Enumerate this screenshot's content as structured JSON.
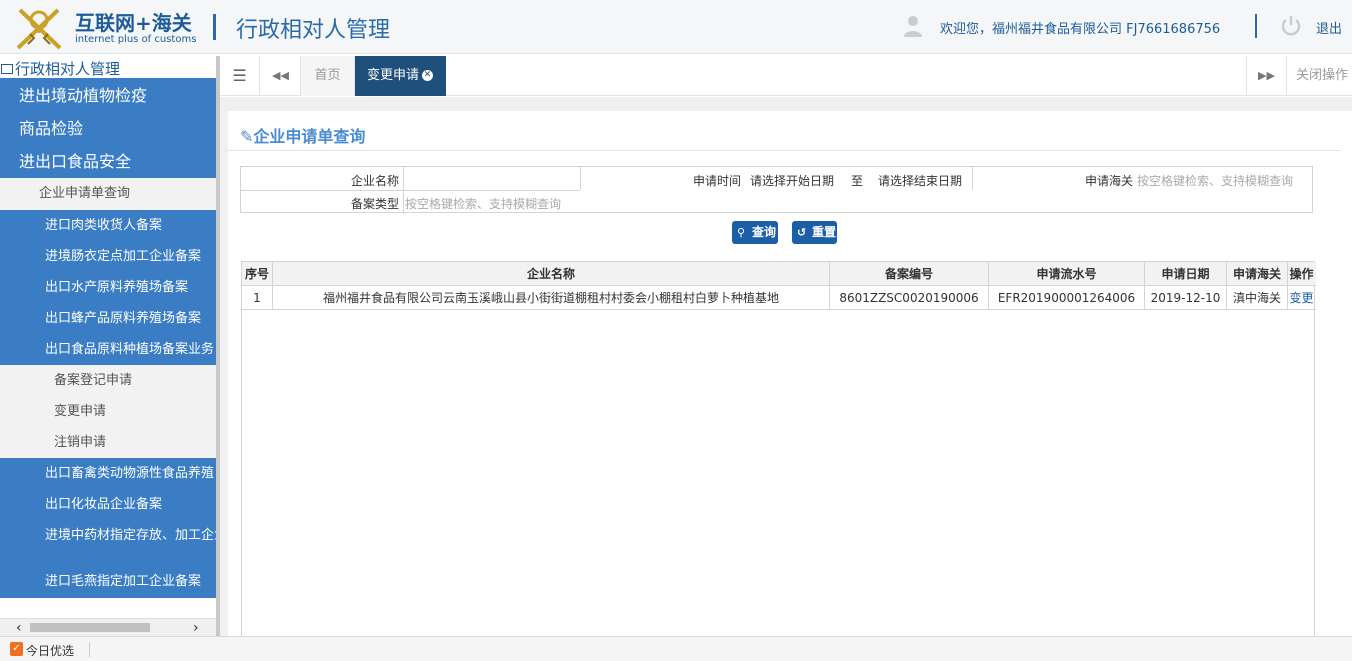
{
  "header": {
    "logo_cn": "互联网+海关",
    "logo_en": "internet plus of customs",
    "app_title": "行政相对人管理",
    "welcome": "欢迎您，福州福井食品有限公司 FJ7661686756",
    "logout": "退出"
  },
  "sidebar": {
    "root": "行政相对人管理",
    "main_items": [
      "进出境动植物检疫",
      "商品检验",
      "进出口食品安全"
    ],
    "active_item": "企业申请单查询",
    "sub_items_a": [
      "进口肉类收货人备案",
      "进境肠衣定点加工企业备案",
      "出口水产原料养殖场备案",
      "出口蜂产品原料养殖场备案",
      "出口食品原料种植场备案业务"
    ],
    "leaf_items": [
      "备案登记申请",
      "变更申请",
      "注销申请"
    ],
    "sub_items_b": [
      "出口畜禽类动物源性食品养殖",
      "出口化妆品企业备案",
      "进境中药材指定存放、加工企业"
    ],
    "sub_item_last": "进口毛燕指定加工企业备案"
  },
  "tabs": {
    "home": "首页",
    "active": "变更申请",
    "close_ops": "关闭操作"
  },
  "panel": {
    "title": "企业申请单查询"
  },
  "form": {
    "company_name_label": "企业名称",
    "apply_time_label": "申请时间",
    "start_date_placeholder": "请选择开始日期",
    "to": "至",
    "end_date_placeholder": "请选择结束日期",
    "customs_label": "申请海关",
    "customs_placeholder": "按空格键检索、支持模糊查询",
    "record_type_label": "备案类型",
    "record_type_placeholder": "按空格键检索、支持模糊查询"
  },
  "buttons": {
    "query": "查询",
    "reset": "重置"
  },
  "table": {
    "columns": [
      "序号",
      "企业名称",
      "备案编号",
      "申请流水号",
      "申请日期",
      "申请海关",
      "操作"
    ],
    "rows": [
      {
        "no": "1",
        "company": "福州福井食品有限公司云南玉溪峨山县小街街道棚租村村委会小棚租村白萝卜种植基地",
        "record_no": "8601ZZSC0020190006",
        "serial_no": "EFR201900001264006",
        "date": "2019-12-10",
        "customs": "滇中海关",
        "action": "变更"
      }
    ]
  },
  "taskbar": {
    "label": "今日优选"
  },
  "colors": {
    "sidebar_blue": "#3a7dc4",
    "active_tab": "#1f4f7b",
    "button": "#1c5fa6",
    "title_blue": "#4a8cd0"
  }
}
